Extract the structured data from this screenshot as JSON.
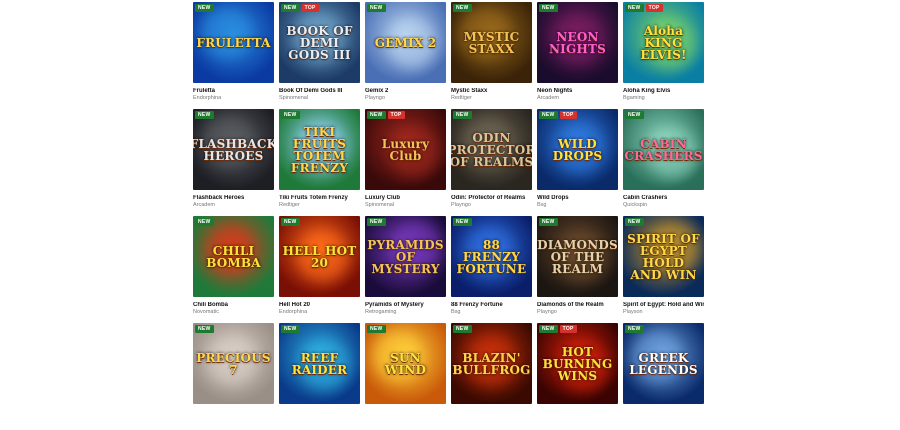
{
  "badges": {
    "new": "NEW",
    "top": "TOP"
  },
  "games": [
    {
      "name": "Fruletta",
      "provider": "Endorphina",
      "art_text": "FRULETTA",
      "new": true,
      "top": false,
      "bg": [
        "#0b3aa3",
        "#2b8fe0"
      ],
      "text_color": "#ffd84a"
    },
    {
      "name": "Book Of Demi Gods III",
      "provider": "Spinomenal",
      "art_text": "BOOK OF DEMI GODS III",
      "new": true,
      "top": true,
      "bg": [
        "#1c3b66",
        "#6fa3c9"
      ],
      "text_color": "#e8eef5"
    },
    {
      "name": "Gemix 2",
      "provider": "Playngo",
      "art_text": "GEMIX 2",
      "new": true,
      "top": false,
      "bg": [
        "#4a6fb5",
        "#b9d3f0"
      ],
      "text_color": "#ffd84a"
    },
    {
      "name": "Mystic Staxx",
      "provider": "Redtiger",
      "art_text": "MYSTIC STAXX",
      "new": true,
      "top": false,
      "bg": [
        "#3a2308",
        "#9a6a1c"
      ],
      "text_color": "#f2c357"
    },
    {
      "name": "Neon Nights",
      "provider": "Arcadem",
      "art_text": "NEON NIGHTS",
      "new": true,
      "top": false,
      "bg": [
        "#1a0c2c",
        "#7a1e62"
      ],
      "text_color": "#ff5fd0"
    },
    {
      "name": "Aloha King Elvis",
      "provider": "Bgaming",
      "art_text": "Aloha KING ELVIS!",
      "new": true,
      "top": true,
      "bg": [
        "#0a7fa3",
        "#7bd36a"
      ],
      "text_color": "#ffe23a"
    },
    {
      "name": "Flashback Heroes",
      "provider": "Arcadem",
      "art_text": "FLASHBACK HEROES",
      "new": true,
      "top": false,
      "bg": [
        "#1d1f24",
        "#5b5e63"
      ],
      "text_color": "#e6e6e6"
    },
    {
      "name": "Tiki Fruits Totem Frenzy",
      "provider": "Redtiger",
      "art_text": "TIKI FRUITS TOTEM FRENZY",
      "new": true,
      "top": false,
      "bg": [
        "#1f7a3a",
        "#8fd0f0"
      ],
      "text_color": "#ffd84a"
    },
    {
      "name": "Luxury Club",
      "provider": "Spinomenal",
      "art_text": "Luxury Club",
      "new": true,
      "top": true,
      "bg": [
        "#3a0a0a",
        "#a0281e"
      ],
      "text_color": "#f2c357"
    },
    {
      "name": "Odin: Protector of Realms",
      "provider": "Playngo",
      "art_text": "ODIN PROTECTOR OF REALMS",
      "new": true,
      "top": false,
      "bg": [
        "#2a2620",
        "#6e6553"
      ],
      "text_color": "#d9c79a"
    },
    {
      "name": "Wild Drops",
      "provider": "Bsg",
      "art_text": "WILD DROPS",
      "new": true,
      "top": true,
      "bg": [
        "#0a2a6a",
        "#2f7be0"
      ],
      "text_color": "#ffe23a"
    },
    {
      "name": "Cabin Crashers",
      "provider": "Quickspin",
      "art_text": "CABIN CRASHERS",
      "new": true,
      "top": false,
      "bg": [
        "#2a6f5a",
        "#8ed6c0"
      ],
      "text_color": "#ff6a9a"
    },
    {
      "name": "Chili Bomba",
      "provider": "Novomatic",
      "art_text": "CHILI BOMBA",
      "new": true,
      "top": false,
      "bg": [
        "#1f7a3a",
        "#d63b1c"
      ],
      "text_color": "#ffe23a"
    },
    {
      "name": "Hell Hot 20",
      "provider": "Endorphina",
      "art_text": "HELL HOT 20",
      "new": true,
      "top": false,
      "bg": [
        "#7a0f05",
        "#ff6a1a"
      ],
      "text_color": "#ffe23a"
    },
    {
      "name": "Pyramids of Mystery",
      "provider": "Retrogaming",
      "art_text": "PYRAMIDS OF MYSTERY",
      "new": true,
      "top": false,
      "bg": [
        "#1a0c3a",
        "#7a3ac0"
      ],
      "text_color": "#f2c357"
    },
    {
      "name": "88 Frenzy Fortune",
      "provider": "Bsg",
      "art_text": "88 FRENZY FORTUNE",
      "new": true,
      "top": false,
      "bg": [
        "#0a1e6a",
        "#2f6fe0"
      ],
      "text_color": "#ffd84a"
    },
    {
      "name": "Diamonds of the Realm",
      "provider": "Playngo",
      "art_text": "DIAMONDS OF THE REALM",
      "new": true,
      "top": false,
      "bg": [
        "#1c1612",
        "#6b4a2c"
      ],
      "text_color": "#e6d2a8"
    },
    {
      "name": "Spirit of Egypt: Hold and Win",
      "provider": "Playson",
      "art_text": "SPIRIT OF EGYPT HOLD AND WIN",
      "new": true,
      "top": false,
      "bg": [
        "#0a2a5a",
        "#c9952a"
      ],
      "text_color": "#ffd84a"
    },
    {
      "name": "",
      "provider": "",
      "art_text": "PRECIOUS 7",
      "new": true,
      "top": false,
      "bg": [
        "#9a8f87",
        "#d9cfc6"
      ],
      "text_color": "#ffd84a"
    },
    {
      "name": "",
      "provider": "",
      "art_text": "REEF RAIDER",
      "new": true,
      "top": false,
      "bg": [
        "#0a3a8a",
        "#2fb0e0"
      ],
      "text_color": "#ffe23a"
    },
    {
      "name": "",
      "provider": "",
      "art_text": "SUN WIND",
      "new": true,
      "top": false,
      "bg": [
        "#c95a0a",
        "#ffcf3a"
      ],
      "text_color": "#ffe23a"
    },
    {
      "name": "",
      "provider": "",
      "art_text": "BLAZIN' BULLFROG",
      "new": true,
      "top": false,
      "bg": [
        "#3a0a02",
        "#c9300a"
      ],
      "text_color": "#ffd84a"
    },
    {
      "name": "",
      "provider": "",
      "art_text": "HOT BURNING WINS",
      "new": true,
      "top": true,
      "bg": [
        "#3a0402",
        "#d6200a"
      ],
      "text_color": "#ffe23a"
    },
    {
      "name": "",
      "provider": "",
      "art_text": "GREEK LEGENDS",
      "new": true,
      "top": false,
      "bg": [
        "#0a2a6a",
        "#6fa3e0"
      ],
      "text_color": "#ffffff"
    }
  ]
}
